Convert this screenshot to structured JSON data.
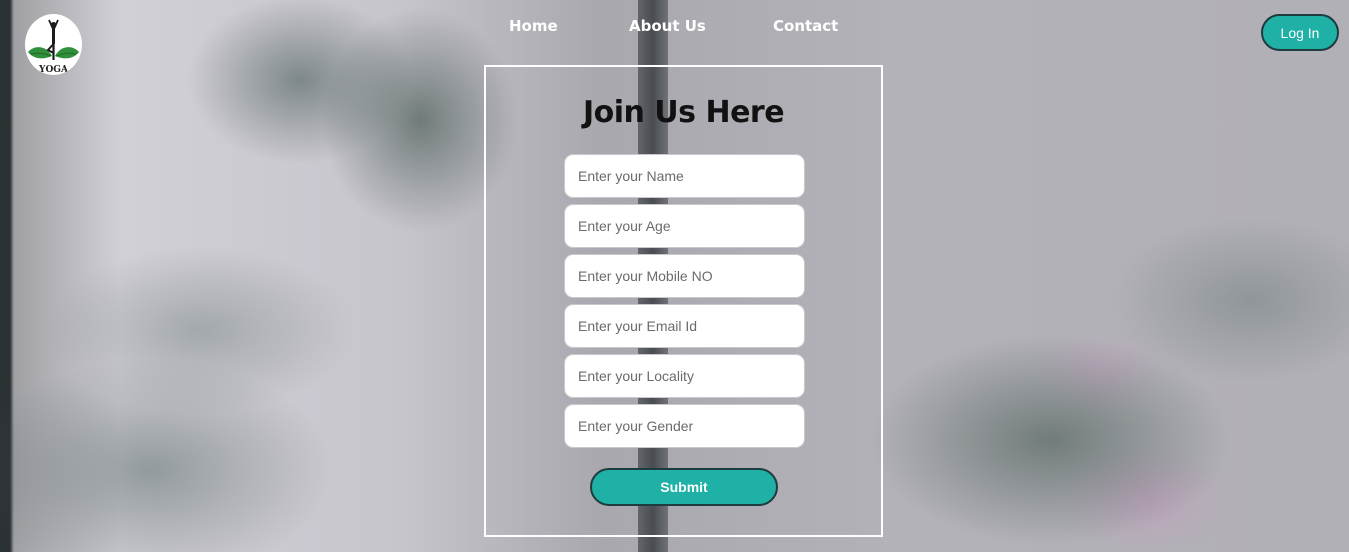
{
  "brand": {
    "logo_text": "YOGA",
    "logo_icon": "yoga-pose-icon"
  },
  "nav": {
    "items": [
      {
        "label": "Home"
      },
      {
        "label": "About Us"
      },
      {
        "label": "Contact"
      }
    ]
  },
  "header": {
    "login_label": "Log In"
  },
  "form": {
    "title": "Join Us Here",
    "fields": [
      {
        "placeholder": "Enter your Name",
        "value": ""
      },
      {
        "placeholder": "Enter your Age",
        "value": ""
      },
      {
        "placeholder": "Enter your Mobile NO",
        "value": ""
      },
      {
        "placeholder": "Enter your Email Id",
        "value": ""
      },
      {
        "placeholder": "Enter your Locality",
        "value": ""
      },
      {
        "placeholder": "Enter your Gender",
        "value": ""
      }
    ],
    "submit_label": "Submit"
  },
  "colors": {
    "accent": "#1fb0a6",
    "accent_border": "#1e3b3d",
    "form_border": "#ffffff",
    "title_text": "#111111"
  }
}
